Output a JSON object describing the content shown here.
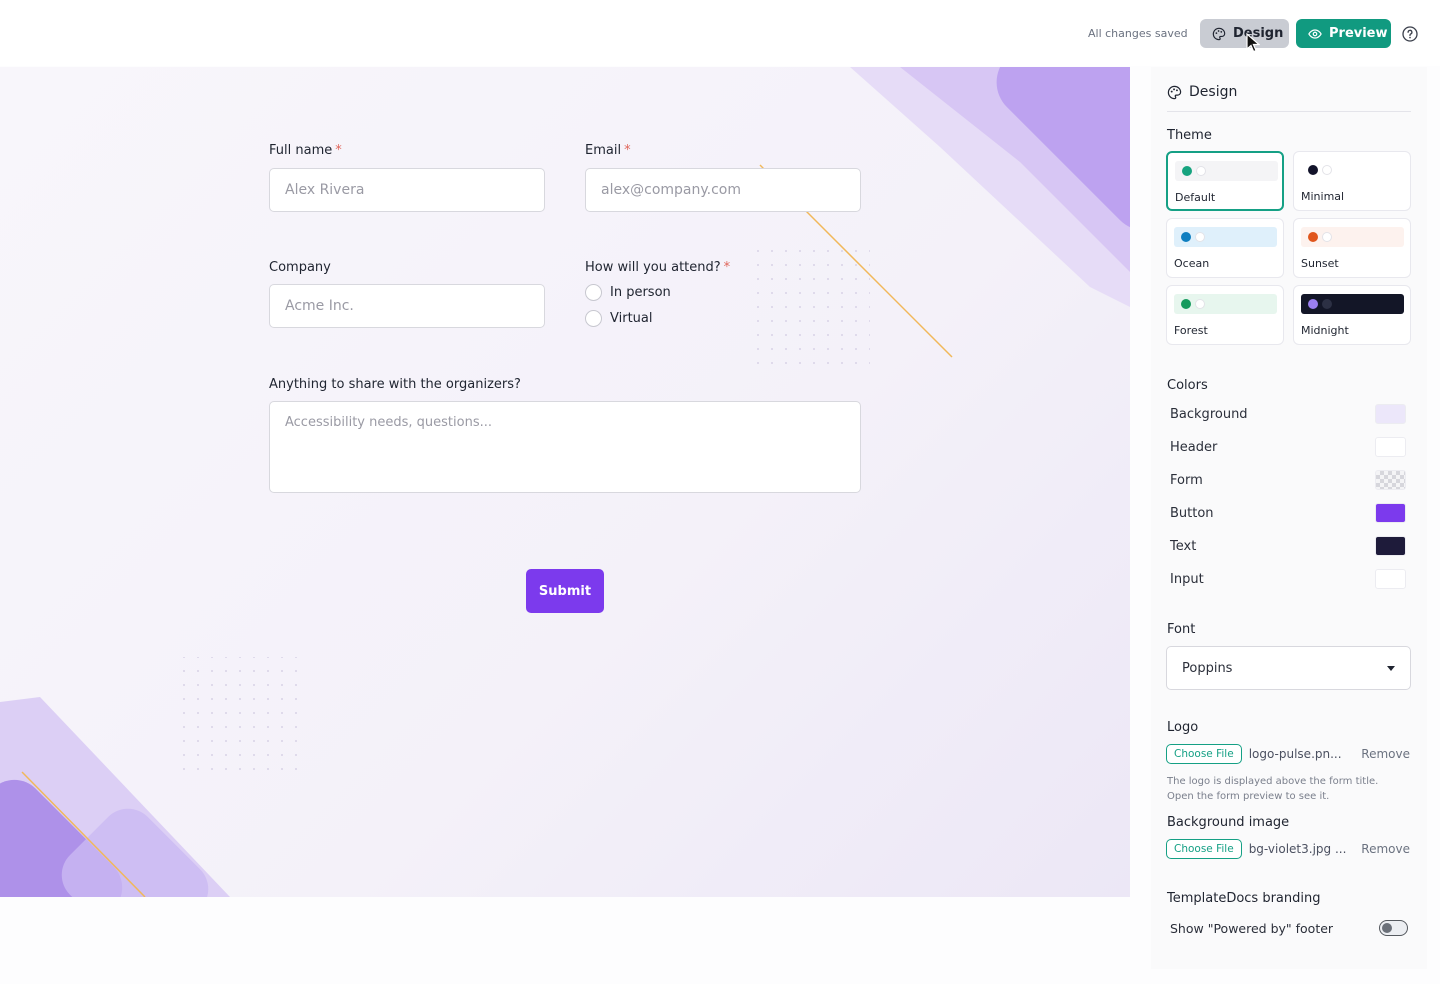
{
  "header": {
    "saved_status": "All changes saved",
    "design_label": "Design",
    "preview_label": "Preview"
  },
  "form": {
    "full_name": {
      "label": "Full name",
      "required_mark": "*",
      "placeholder": "Alex Rivera"
    },
    "email": {
      "label": "Email",
      "required_mark": "*",
      "placeholder": "alex@company.com"
    },
    "company": {
      "label": "Company",
      "placeholder": "Acme Inc."
    },
    "attend": {
      "label": "How will you attend?",
      "required_mark": "*",
      "options": [
        "In person",
        "Virtual"
      ]
    },
    "notes": {
      "label": "Anything to share with the organizers?",
      "placeholder": "Accessibility needs, questions..."
    },
    "submit_label": "Submit"
  },
  "panel": {
    "title": "Design",
    "theme_label": "Theme",
    "themes": [
      {
        "name": "Default",
        "bar": "#f4f4f6",
        "dot1": "#16a37f",
        "dot2": "#ffffff",
        "selected": true
      },
      {
        "name": "Minimal",
        "bar": "#ffffff",
        "dot1": "#12132a",
        "dot2": "#ffffff",
        "selected": false
      },
      {
        "name": "Ocean",
        "bar": "#dff0fb",
        "dot1": "#0e7ec0",
        "dot2": "#ffffff",
        "selected": false
      },
      {
        "name": "Sunset",
        "bar": "#fdf2ee",
        "dot1": "#e0561c",
        "dot2": "#ffffff",
        "selected": false
      },
      {
        "name": "Forest",
        "bar": "#e7f6ee",
        "dot1": "#159a5d",
        "dot2": "#ffffff",
        "selected": false
      },
      {
        "name": "Midnight",
        "bar": "#131627",
        "dot1": "#9b7ff0",
        "dot2": "#2c3044",
        "selected": false
      }
    ],
    "colors_label": "Colors",
    "colors": [
      {
        "name": "Background",
        "value": "#ece7fa"
      },
      {
        "name": "Header",
        "value": "#ffffff"
      },
      {
        "name": "Form",
        "value": "transparent"
      },
      {
        "name": "Button",
        "value": "#7c3aed"
      },
      {
        "name": "Text",
        "value": "#1e1b3a"
      },
      {
        "name": "Input",
        "value": "#ffffff"
      }
    ],
    "font_label": "Font",
    "font_value": "Poppins",
    "logo_label": "Logo",
    "choose_file": "Choose File",
    "logo_file": "logo-pulse.pn...",
    "remove": "Remove",
    "logo_hint": "The logo is displayed above the form title. Open the form preview to see it.",
    "bg_image_label": "Background image",
    "bg_file": "bg-violet3.jpg ...",
    "branding_label": "TemplateDocs branding",
    "powered_by": "Show \"Powered by\" footer"
  }
}
